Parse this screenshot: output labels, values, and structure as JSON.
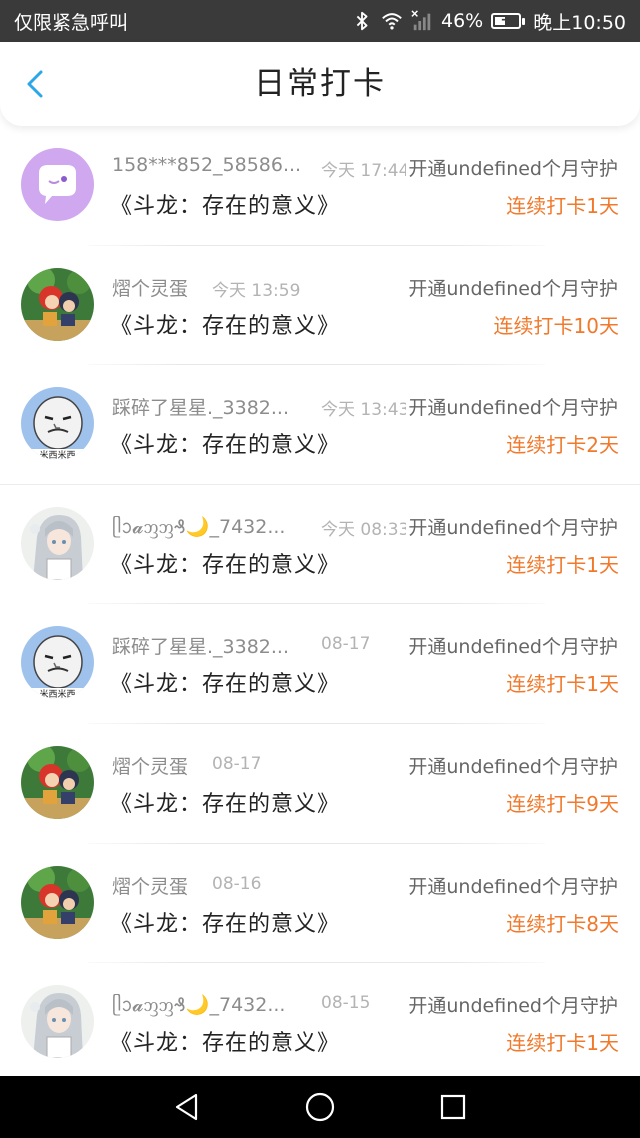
{
  "status_bar": {
    "carrier": "仅限紧急呼叫",
    "battery": "46%",
    "battery_level": 0.46,
    "time": "晚上10:50",
    "icons": [
      "bluetooth-icon",
      "wifi-icon",
      "no-signal-icon",
      "battery-icon"
    ]
  },
  "header": {
    "title": "日常打卡",
    "back_icon": "chevron-left-icon",
    "accent_color": "#2aa7e8"
  },
  "colors": {
    "streak": "#f0792b",
    "name": "#8c8c8c",
    "time": "#b3b3b3",
    "statusbar_bg": "#3a3a3a"
  },
  "items": [
    {
      "name": "158***852_58586...",
      "time": "今天 17:44",
      "guard": "开通undefined个月守护",
      "work": "《斗龙：存在的意义》",
      "streak": "连续打卡1天",
      "avatar": "purple-chat-avatar"
    },
    {
      "name": "熠个灵蛋",
      "time": "今天 13:59",
      "guard": "开通undefined个月守护",
      "work": "《斗龙：存在的意义》",
      "streak": "连续打卡10天",
      "avatar": "anime-duo-avatar"
    },
    {
      "name": "踩碎了星星._3382...",
      "time": "今天 13:43",
      "guard": "开通undefined个月守护",
      "work": "《斗龙：存在的意义》",
      "streak": "连续打卡2天",
      "avatar": "meme-face-avatar"
    },
    {
      "name": "ᥫᩣ𝓪ᦀᦀ₰🌙_7432...",
      "time": "今天 08:33",
      "guard": "开通undefined个月守护",
      "work": "《斗龙：存在的意义》",
      "streak": "连续打卡1天",
      "avatar": "silver-hair-avatar"
    },
    {
      "name": "踩碎了星星._3382...",
      "time": "08-17",
      "guard": "开通undefined个月守护",
      "work": "《斗龙：存在的意义》",
      "streak": "连续打卡1天",
      "avatar": "meme-face-avatar"
    },
    {
      "name": "熠个灵蛋",
      "time": "08-17",
      "guard": "开通undefined个月守护",
      "work": "《斗龙：存在的意义》",
      "streak": "连续打卡9天",
      "avatar": "anime-duo-avatar"
    },
    {
      "name": "熠个灵蛋",
      "time": "08-16",
      "guard": "开通undefined个月守护",
      "work": "《斗龙：存在的意义》",
      "streak": "连续打卡8天",
      "avatar": "anime-duo-avatar"
    },
    {
      "name": "ᥫᩣ𝓪ᦀᦀ₰🌙_7432...",
      "time": "08-15",
      "guard": "开通undefined个月守护",
      "work": "《斗龙：存在的意义》",
      "streak": "连续打卡1天",
      "avatar": "silver-hair-avatar"
    }
  ],
  "nav_bar": {
    "buttons": [
      "back-triangle-icon",
      "home-circle-icon",
      "recents-square-icon"
    ]
  }
}
